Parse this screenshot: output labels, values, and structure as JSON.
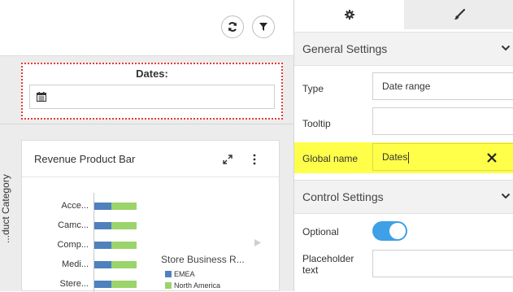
{
  "canvas": {
    "dates_control": {
      "label": "Dates:"
    },
    "chart_card": {
      "title": "Revenue Product Bar",
      "chart_data": {
        "type": "bar",
        "orientation": "horizontal",
        "stacked": true,
        "ylabel": "...duct Category",
        "categories": [
          "Acce...",
          "Camc...",
          "Comp...",
          "Medi...",
          "Stere..."
        ],
        "series": [
          {
            "name": "EMEA",
            "values": [
              0.4,
              0.4,
              0.4,
              0.4,
              0.4
            ],
            "color": "#4f81bd"
          },
          {
            "name": "North America",
            "values": [
              0.6,
              0.6,
              0.6,
              0.6,
              0.6
            ],
            "color": "#9bd46a"
          }
        ],
        "legend": {
          "title": "Store Business R...",
          "placement": "right"
        }
      }
    }
  },
  "panel": {
    "tabs": [
      {
        "name": "settings",
        "icon": "gear-icon"
      },
      {
        "name": "style",
        "icon": "paintbrush-icon"
      }
    ],
    "general": {
      "title": "General Settings",
      "type_label": "Type",
      "type_value": "Date range",
      "tooltip_label": "Tooltip",
      "tooltip_value": "",
      "global_name_label": "Global name",
      "global_name_value": "Dates"
    },
    "control": {
      "title": "Control Settings",
      "optional_label": "Optional",
      "optional_on": true,
      "placeholder_label": "Placeholder text",
      "placeholder_value": ""
    },
    "colors": {
      "highlight": "#ffff4a",
      "toggle": "#3ea0e6"
    }
  }
}
